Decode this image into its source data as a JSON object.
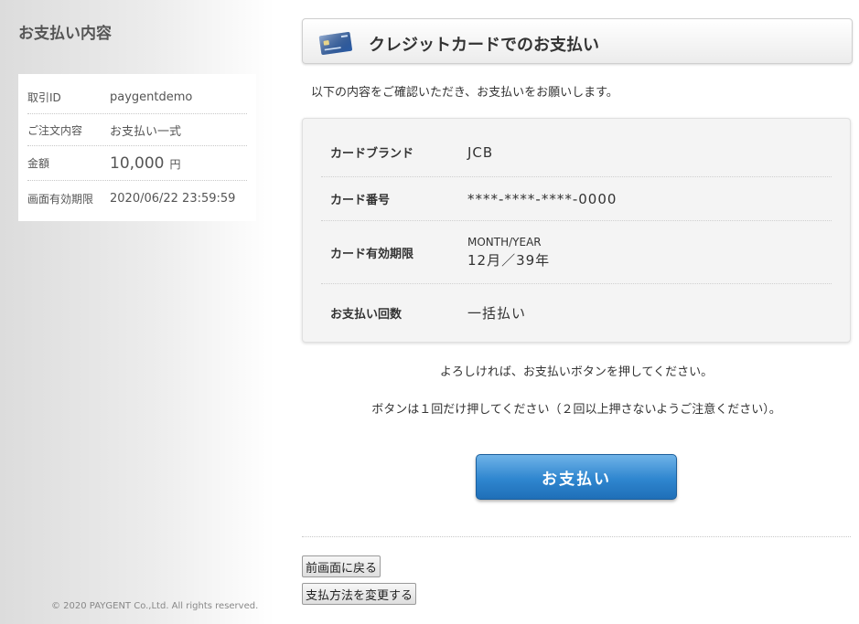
{
  "sidebar": {
    "title": "お支払い内容",
    "summary": {
      "transaction_id_label": "取引ID",
      "transaction_id": "paygentdemo",
      "order_label": "ご注文内容",
      "order_value": "お支払い一式",
      "amount_label": "金額",
      "amount_value": "10,000",
      "amount_unit": "円",
      "deadline_label": "画面有効期限",
      "deadline_value": "2020/06/22 23:59:59"
    },
    "copyright": "© 2020 PAYGENT Co.,Ltd. All rights reserved."
  },
  "header": {
    "title": "クレジットカードでのお支払い",
    "icon": "credit-card-icon"
  },
  "intro_text": "以下の内容をご確認いただき、お支払いをお願いします。",
  "details": {
    "brand_label": "カードブランド",
    "brand_value": "JCB",
    "number_label": "カード番号",
    "number_value": "****-****-****-0000",
    "expiry_label": "カード有効期限",
    "expiry_caption": "MONTH/YEAR",
    "expiry_value": "12月／39年",
    "installments_label": "お支払い回数",
    "installments_value": "一括払い"
  },
  "notices": {
    "confirm": "よろしければ、お支払いボタンを押してください。",
    "once": "ボタンは１回だけ押してください（２回以上押さないようご注意ください）。"
  },
  "buttons": {
    "pay": "お支払い",
    "back": "前画面に戻る",
    "change_method": "支払方法を変更する"
  },
  "colors": {
    "pay_button": "#2f86cf",
    "card_icon": "#2d5ea8"
  }
}
